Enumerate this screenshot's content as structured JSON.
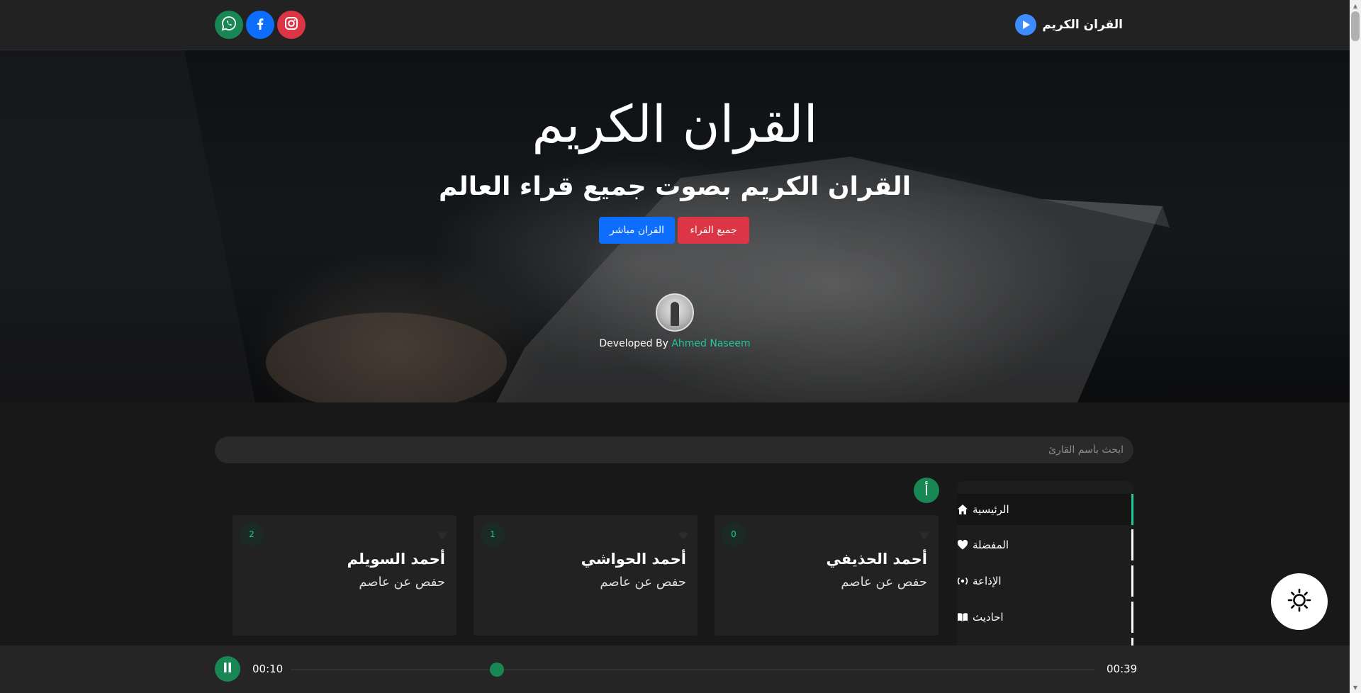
{
  "navbar": {
    "brand": "القران الكريم",
    "brand_icon": "play-circle-icon",
    "socials": [
      {
        "name": "whatsapp",
        "icon": "whatsapp-icon",
        "color": "#198754"
      },
      {
        "name": "facebook",
        "icon": "facebook-icon",
        "color": "#0d6efd"
      },
      {
        "name": "instagram",
        "icon": "instagram-icon",
        "color": "#dc3545"
      }
    ]
  },
  "hero": {
    "title": "القران الكريم",
    "subtitle": "القران الكريم بصوت جميع قراء العالم",
    "btn_live": "القران مباشر",
    "btn_reciters": "جميع القراء",
    "developed_by": "Developed By",
    "developer": "Ahmed Naseem"
  },
  "search": {
    "placeholder": "ابحث بأسم القارئ",
    "value": ""
  },
  "sidebar": {
    "items": [
      {
        "label": "الرئيسية",
        "icon": "home-icon",
        "active": true
      },
      {
        "label": "المفضلة",
        "icon": "heart-icon",
        "active": false
      },
      {
        "label": "الإذاعة",
        "icon": "radio-icon",
        "active": false
      },
      {
        "label": "احاديث",
        "icon": "book-icon",
        "active": false
      }
    ]
  },
  "letter_filter": "أ",
  "cards": [
    {
      "num": "0",
      "name": "أحمد الحذيفي",
      "rewaya": "حفص عن عاصم"
    },
    {
      "num": "1",
      "name": "أحمد الحواشي",
      "rewaya": "حفص عن عاصم"
    },
    {
      "num": "2",
      "name": "أحمد السويلم",
      "rewaya": "حفص عن عاصم"
    }
  ],
  "player": {
    "current_time": "00:10",
    "duration": "00:39",
    "state": "playing",
    "progress": 0.256
  },
  "theme_toggle_icon": "sun-icon",
  "colors": {
    "accent_green": "#198754",
    "teal": "#20c997",
    "primary_blue": "#0d6efd",
    "danger_red": "#dc3545"
  }
}
